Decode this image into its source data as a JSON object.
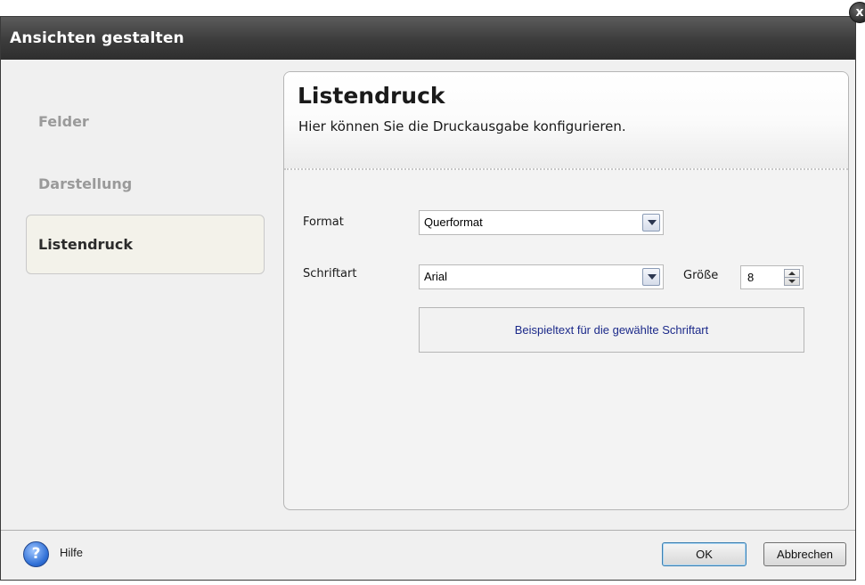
{
  "dialog": {
    "title": "Ansichten gestalten",
    "close_label": "x"
  },
  "sidebar": {
    "items": [
      {
        "label": "Felder",
        "active": false
      },
      {
        "label": "Darstellung",
        "active": false
      },
      {
        "label": "Listendruck",
        "active": true
      }
    ]
  },
  "panel": {
    "title": "Listendruck",
    "subtitle": "Hier können Sie die Druckausgabe konfigurieren.",
    "format": {
      "label": "Format",
      "value": "Querformat"
    },
    "font": {
      "label": "Schriftart",
      "value": "Arial"
    },
    "size": {
      "label": "Größe",
      "value": "8"
    },
    "preview_text": "Beispieltext für die gewählte Schriftart"
  },
  "footer": {
    "help_icon_glyph": "?",
    "help_label": "Hilfe",
    "ok_label": "OK",
    "cancel_label": "Abbrechen"
  }
}
